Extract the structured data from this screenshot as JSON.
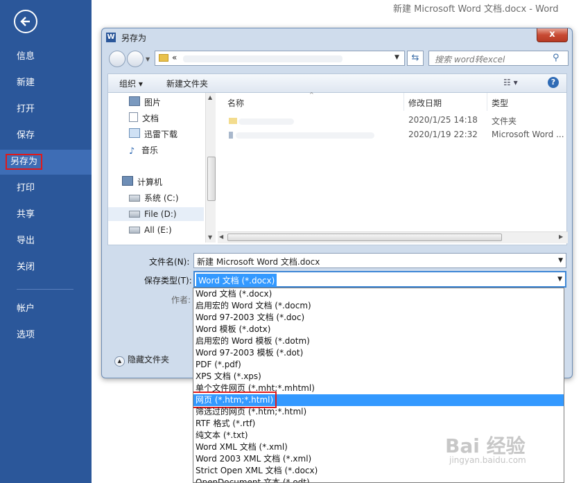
{
  "app_title": "新建 Microsoft Word 文档.docx - Word",
  "sidebar": {
    "items": [
      {
        "label": "信息"
      },
      {
        "label": "新建"
      },
      {
        "label": "打开"
      },
      {
        "label": "保存"
      },
      {
        "label": "另存为"
      },
      {
        "label": "打印"
      },
      {
        "label": "共享"
      },
      {
        "label": "导出"
      },
      {
        "label": "关闭"
      },
      {
        "label": "帐户"
      },
      {
        "label": "选项"
      }
    ],
    "active": "另存为"
  },
  "dialog": {
    "title": "另存为",
    "close_glyph": "x",
    "address_prefix": "«",
    "search_placeholder": "搜索 word转excel",
    "toolbar": {
      "organize": "组织 ▾",
      "new_folder": "新建文件夹"
    },
    "nav_items": [
      {
        "label": "图片",
        "icon": "pictures-icon"
      },
      {
        "label": "文档",
        "icon": "documents-icon"
      },
      {
        "label": "迅雷下载",
        "icon": "download-icon"
      },
      {
        "label": "音乐",
        "icon": "music-icon"
      },
      {
        "label": "计算机",
        "icon": "computer-icon"
      },
      {
        "label": "系统 (C:)",
        "icon": "drive-icon"
      },
      {
        "label": "File (D:)",
        "icon": "drive-icon"
      },
      {
        "label": "All (E:)",
        "icon": "drive-icon"
      }
    ],
    "columns": {
      "name": "名称",
      "modified": "修改日期",
      "type": "类型"
    },
    "files": [
      {
        "modified": "2020/1/25 14:18",
        "type": "文件夹"
      },
      {
        "modified": "2020/1/19 22:32",
        "type": "Microsoft Word ..."
      }
    ],
    "filename_label": "文件名(N):",
    "filename_value": "新建 Microsoft Word 文档.docx",
    "filetype_label": "保存类型(T):",
    "filetype_value": "Word 文档 (*.docx)",
    "author_label": "作者:",
    "hide_folders": "隐藏文件夹",
    "filetype_options": [
      "Word 文档 (*.docx)",
      "启用宏的 Word 文档 (*.docm)",
      "Word 97-2003 文档 (*.doc)",
      "Word 模板 (*.dotx)",
      "启用宏的 Word 模板 (*.dotm)",
      "Word 97-2003 模板 (*.dot)",
      "PDF (*.pdf)",
      "XPS 文档 (*.xps)",
      "单个文件网页 (*.mht;*.mhtml)",
      "网页 (*.htm;*.html)",
      "筛选过的网页 (*.htm;*.html)",
      "RTF 格式 (*.rtf)",
      "纯文本 (*.txt)",
      "Word XML 文档 (*.xml)",
      "Word 2003 XML 文档 (*.xml)",
      "Strict Open XML 文档 (*.docx)",
      "OpenDocument 文本 (*.odt)"
    ],
    "selected_option": "网页 (*.htm;*.html)"
  },
  "watermark": {
    "logo": "Bai 经验",
    "url": "jingyan.baidu.com"
  },
  "colors": {
    "sidebar": "#2b579a",
    "highlight": "#3399ff",
    "callout": "#e0191a"
  }
}
